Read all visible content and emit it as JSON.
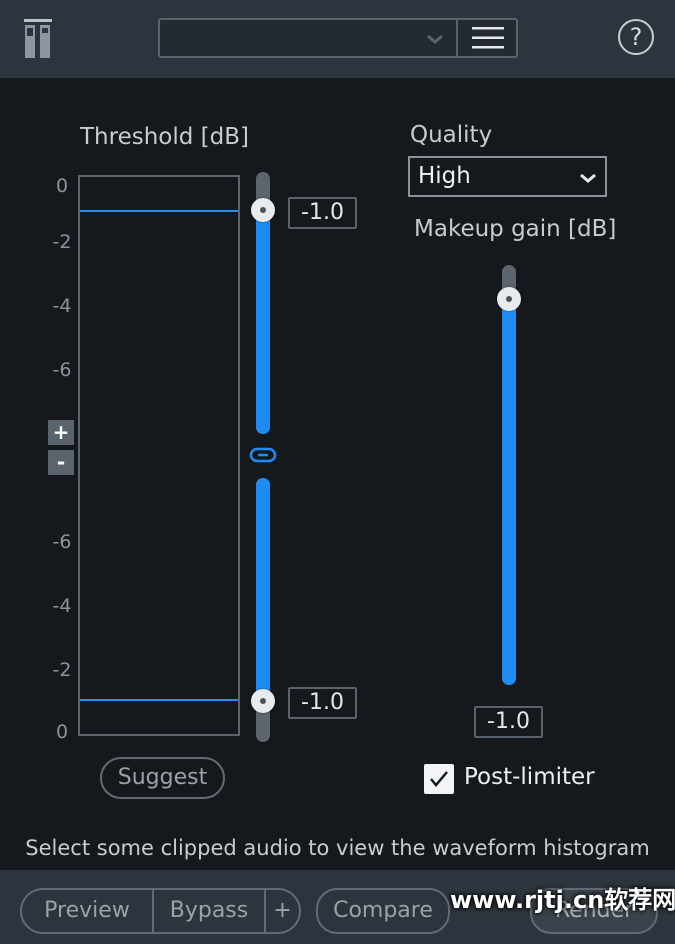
{
  "topbar": {
    "preset_value": "",
    "help_label": "?"
  },
  "threshold": {
    "title": "Threshold [dB]",
    "ticks_upper": [
      "0",
      "-2",
      "-4",
      "-6"
    ],
    "ticks_lower": [
      "-6",
      "-4",
      "-2",
      "0"
    ],
    "zoom_in_label": "+",
    "zoom_out_label": "-",
    "upper_value": "-1.0",
    "lower_value": "-1.0",
    "suggest_label": "Suggest"
  },
  "quality": {
    "title": "Quality",
    "selected": "High"
  },
  "makeup_gain": {
    "title": "Makeup gain [dB]",
    "value": "-1.0"
  },
  "post_limiter": {
    "label": "Post-limiter",
    "checked": true
  },
  "hint": "Select some clipped audio to view the waveform histogram",
  "bottombar": {
    "preview_label": "Preview",
    "bypass_label": "Bypass",
    "add_label": "+",
    "compare_label": "Compare",
    "render_label": "Render"
  },
  "watermark": "www.rjtj.cn软荐网",
  "colors": {
    "accent": "#1e8cf5",
    "background": "#15191d",
    "topbar": "#2c343d"
  },
  "icons": [
    "app-logo-icon",
    "chevron-down-icon",
    "menu-icon",
    "help-icon",
    "link-icon",
    "checkmark-icon"
  ]
}
